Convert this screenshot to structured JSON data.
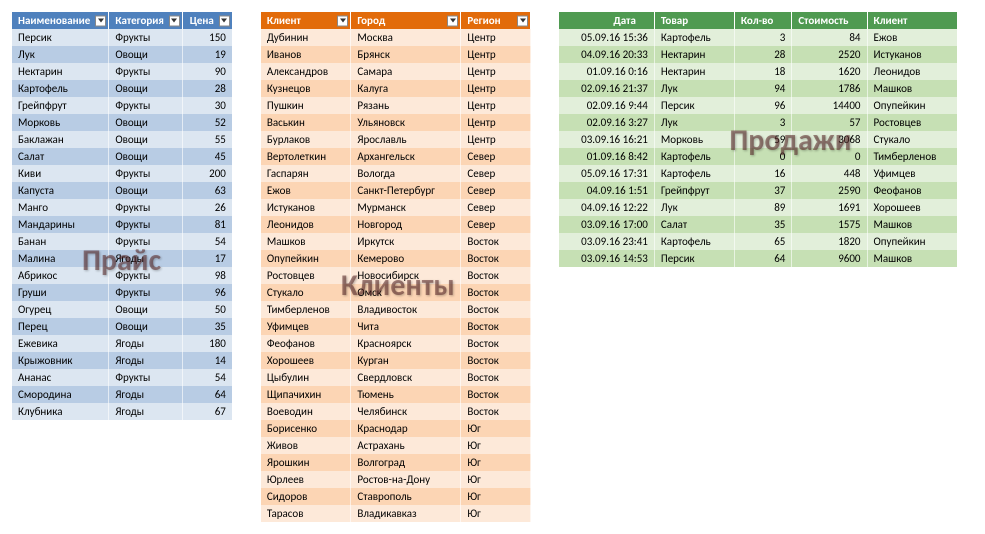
{
  "labels": {
    "price": "Прайс",
    "clients": "Клиенты",
    "sales": "Продажи"
  },
  "price": {
    "headers": [
      "Наименование",
      "Категория",
      "Цена"
    ],
    "rows": [
      [
        "Персик",
        "Фрукты",
        150
      ],
      [
        "Лук",
        "Овощи",
        19
      ],
      [
        "Нектарин",
        "Фрукты",
        90
      ],
      [
        "Картофель",
        "Овощи",
        28
      ],
      [
        "Грейпфрут",
        "Фрукты",
        30
      ],
      [
        "Морковь",
        "Овощи",
        52
      ],
      [
        "Баклажан",
        "Овощи",
        55
      ],
      [
        "Салат",
        "Овощи",
        45
      ],
      [
        "Киви",
        "Фрукты",
        200
      ],
      [
        "Капуста",
        "Овощи",
        63
      ],
      [
        "Манго",
        "Фрукты",
        26
      ],
      [
        "Мандарины",
        "Фрукты",
        81
      ],
      [
        "Банан",
        "Фрукты",
        54
      ],
      [
        "Малина",
        "Ягоды",
        17
      ],
      [
        "Абрикос",
        "Фрукты",
        98
      ],
      [
        "Груши",
        "Фрукты",
        96
      ],
      [
        "Огурец",
        "Овощи",
        50
      ],
      [
        "Перец",
        "Овощи",
        35
      ],
      [
        "Ежевика",
        "Ягоды",
        180
      ],
      [
        "Крыжовник",
        "Ягоды",
        14
      ],
      [
        "Ананас",
        "Фрукты",
        54
      ],
      [
        "Смородина",
        "Ягоды",
        64
      ],
      [
        "Клубника",
        "Ягоды",
        67
      ]
    ]
  },
  "clients": {
    "headers": [
      "Клиент",
      "Город",
      "Регион"
    ],
    "rows": [
      [
        "Дубинин",
        "Москва",
        "Центр"
      ],
      [
        "Иванов",
        "Брянск",
        "Центр"
      ],
      [
        "Александров",
        "Самара",
        "Центр"
      ],
      [
        "Кузнецов",
        "Калуга",
        "Центр"
      ],
      [
        "Пушкин",
        "Рязань",
        "Центр"
      ],
      [
        "Васькин",
        "Ульяновск",
        "Центр"
      ],
      [
        "Бурлаков",
        "Ярославль",
        "Центр"
      ],
      [
        "Вертолеткин",
        "Архангельск",
        "Север"
      ],
      [
        "Гаспарян",
        "Вологда",
        "Север"
      ],
      [
        "Ежов",
        "Санкт-Петербург",
        "Север"
      ],
      [
        "Истуканов",
        "Мурманск",
        "Север"
      ],
      [
        "Леонидов",
        "Новгород",
        "Север"
      ],
      [
        "Машков",
        "Иркутск",
        "Восток"
      ],
      [
        "Опупейкин",
        "Кемерово",
        "Восток"
      ],
      [
        "Ростовцев",
        "Новосибирск",
        "Восток"
      ],
      [
        "Стукало",
        "Омск",
        "Восток"
      ],
      [
        "Тимберленов",
        "Владивосток",
        "Восток"
      ],
      [
        "Уфимцев",
        "Чита",
        "Восток"
      ],
      [
        "Феофанов",
        "Красноярск",
        "Восток"
      ],
      [
        "Хорошеев",
        "Курган",
        "Восток"
      ],
      [
        "Цыбулин",
        "Свердловск",
        "Восток"
      ],
      [
        "Щипачихин",
        "Тюмень",
        "Восток"
      ],
      [
        "Воеводин",
        "Челябинск",
        "Восток"
      ],
      [
        "Борисенко",
        "Краснодар",
        "Юг"
      ],
      [
        "Живов",
        "Астрахань",
        "Юг"
      ],
      [
        "Ярошкин",
        "Волгоград",
        "Юг"
      ],
      [
        "Юрлеев",
        "Ростов-на-Дону",
        "Юг"
      ],
      [
        "Сидоров",
        "Ставрополь",
        "Юг"
      ],
      [
        "Тарасов",
        "Владикавказ",
        "Юг"
      ]
    ]
  },
  "sales": {
    "headers": [
      "Дата",
      "Товар",
      "Кол-во",
      "Стоимость",
      "Клиент"
    ],
    "rows": [
      [
        "05.09.16 15:36",
        "Картофель",
        3,
        84,
        "Ежов"
      ],
      [
        "04.09.16 20:33",
        "Нектарин",
        28,
        2520,
        "Истуканов"
      ],
      [
        "01.09.16 0:16",
        "Нектарин",
        18,
        1620,
        "Леонидов"
      ],
      [
        "02.09.16 21:37",
        "Лук",
        94,
        1786,
        "Машков"
      ],
      [
        "02.09.16 9:44",
        "Персик",
        96,
        14400,
        "Опупейкин"
      ],
      [
        "02.09.16 3:27",
        "Лук",
        3,
        57,
        "Ростовцев"
      ],
      [
        "03.09.16 16:21",
        "Морковь",
        59,
        3068,
        "Стукало"
      ],
      [
        "01.09.16 8:42",
        "Картофель",
        0,
        0,
        "Тимберленов"
      ],
      [
        "05.09.16 17:31",
        "Картофель",
        16,
        448,
        "Уфимцев"
      ],
      [
        "04.09.16 1:51",
        "Грейпфрут",
        37,
        2590,
        "Феофанов"
      ],
      [
        "04.09.16 12:22",
        "Лук",
        89,
        1691,
        "Хорошеев"
      ],
      [
        "03.09.16 17:00",
        "Салат",
        35,
        1575,
        "Машков"
      ],
      [
        "03.09.16 23:41",
        "Картофель",
        65,
        1820,
        "Опупейкин"
      ],
      [
        "03.09.16 14:53",
        "Персик",
        64,
        9600,
        "Машков"
      ]
    ]
  },
  "chart_data": [
    {
      "type": "table",
      "title": "Прайс",
      "columns": [
        "Наименование",
        "Категория",
        "Цена"
      ]
    },
    {
      "type": "table",
      "title": "Клиенты",
      "columns": [
        "Клиент",
        "Город",
        "Регион"
      ]
    },
    {
      "type": "table",
      "title": "Продажи",
      "columns": [
        "Дата",
        "Товар",
        "Кол-во",
        "Стоимость",
        "Клиент"
      ]
    }
  ]
}
